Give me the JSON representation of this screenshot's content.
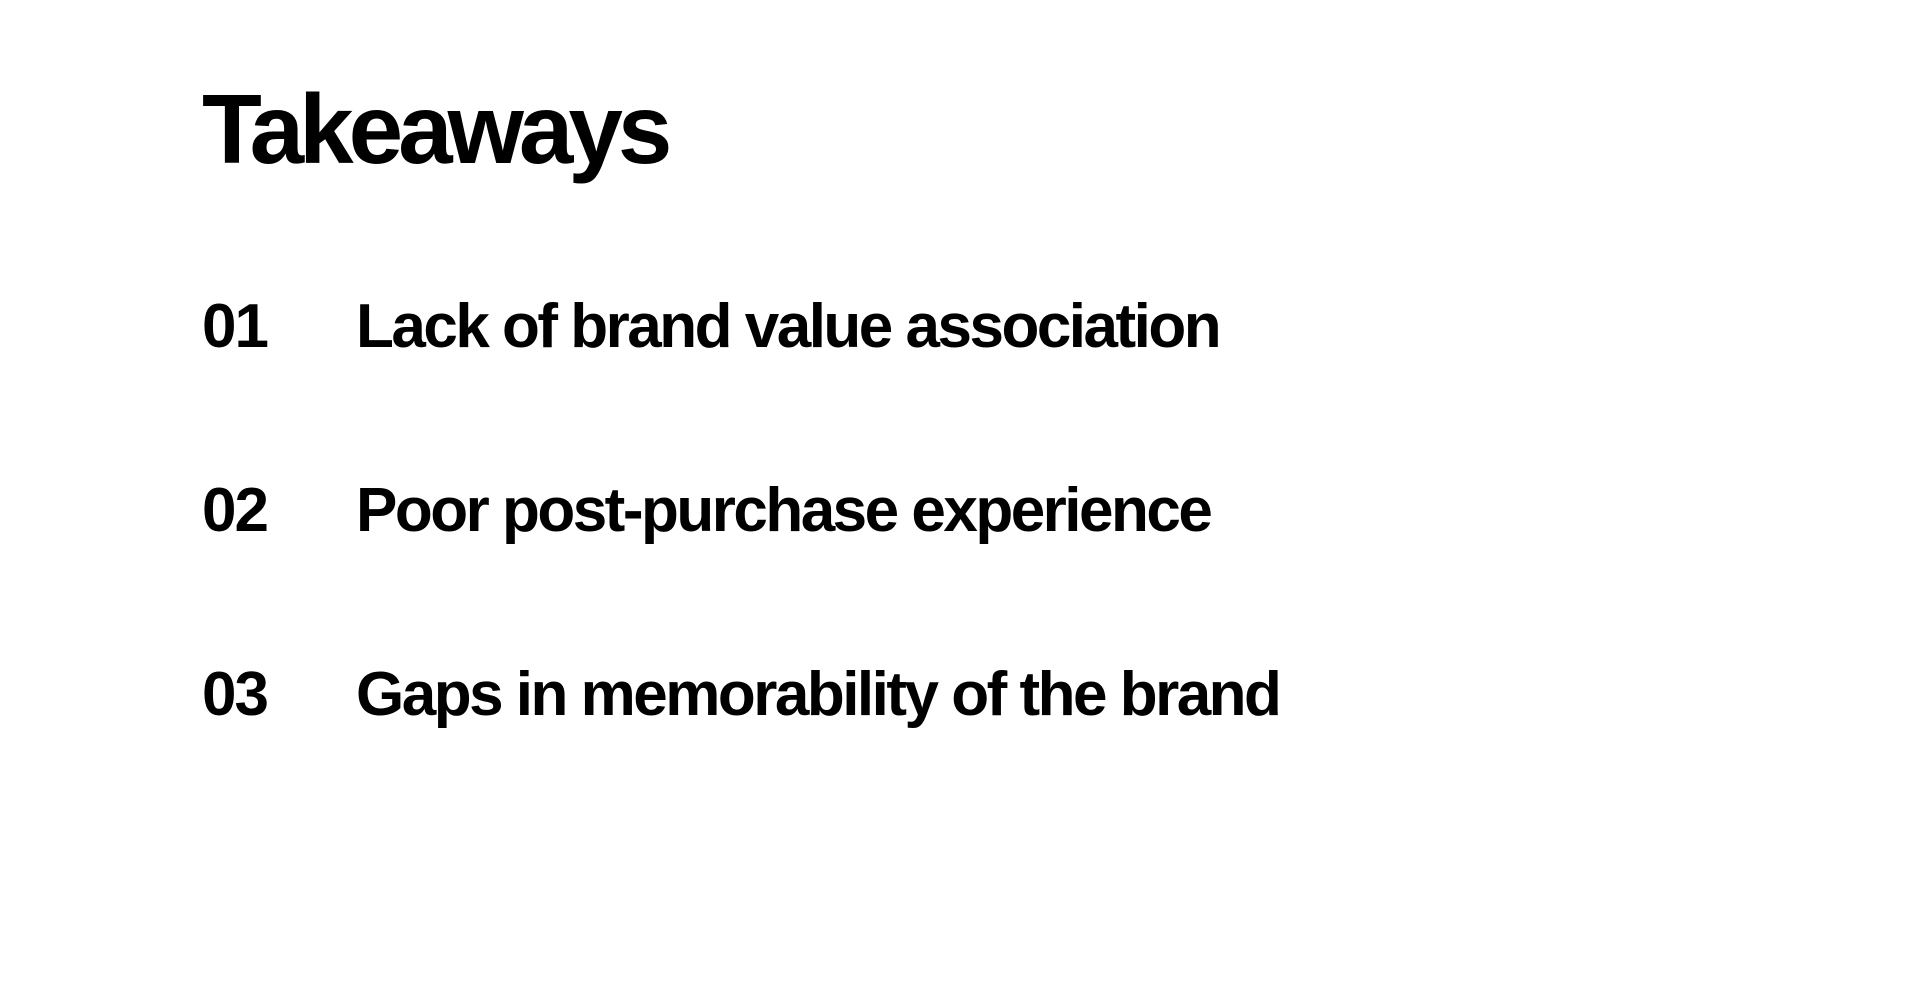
{
  "title": "Takeaways",
  "takeaways": [
    {
      "number": "01",
      "text": "Lack of brand value association"
    },
    {
      "number": "02",
      "text": "Poor post-purchase experience"
    },
    {
      "number": "03",
      "text": "Gaps in memorability of the brand"
    }
  ]
}
